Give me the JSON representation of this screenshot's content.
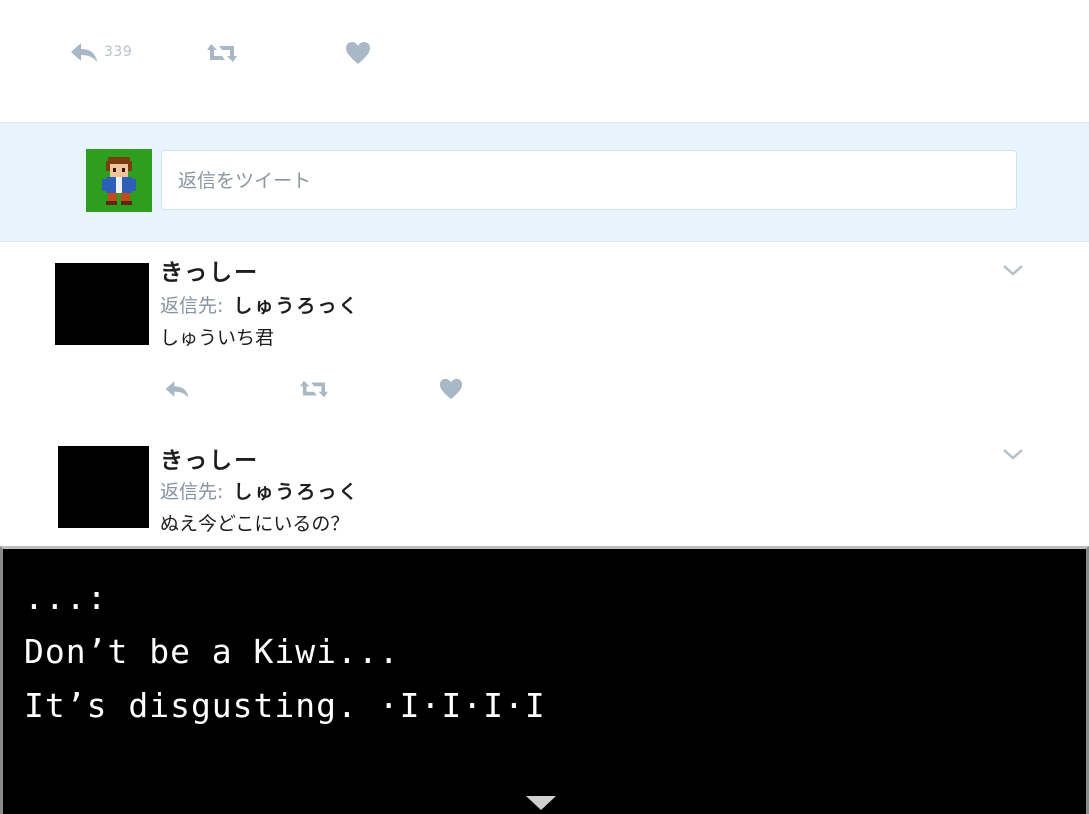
{
  "top_actions": {
    "reply_count": "339"
  },
  "compose": {
    "placeholder": "返信をツイート"
  },
  "tweets": [
    {
      "name": "きっしー",
      "reply_prefix": "返信先:",
      "reply_to": "しゅうろっく",
      "text": "しゅういち君"
    },
    {
      "name": "きっしー",
      "reply_prefix": "返信先:",
      "reply_to": "しゅうろっく",
      "text": "ぬえ今どこにいるの？"
    }
  ],
  "dialog": {
    "lines": [
      "...:",
      "Don’t be a Kiwi...",
      "It’s disgusting. ·I·I·I·I"
    ]
  },
  "colors": {
    "icon": "#a8b8c6",
    "compose_bg": "#e8f4fb",
    "avatar_bg": "#2f9e1f"
  }
}
